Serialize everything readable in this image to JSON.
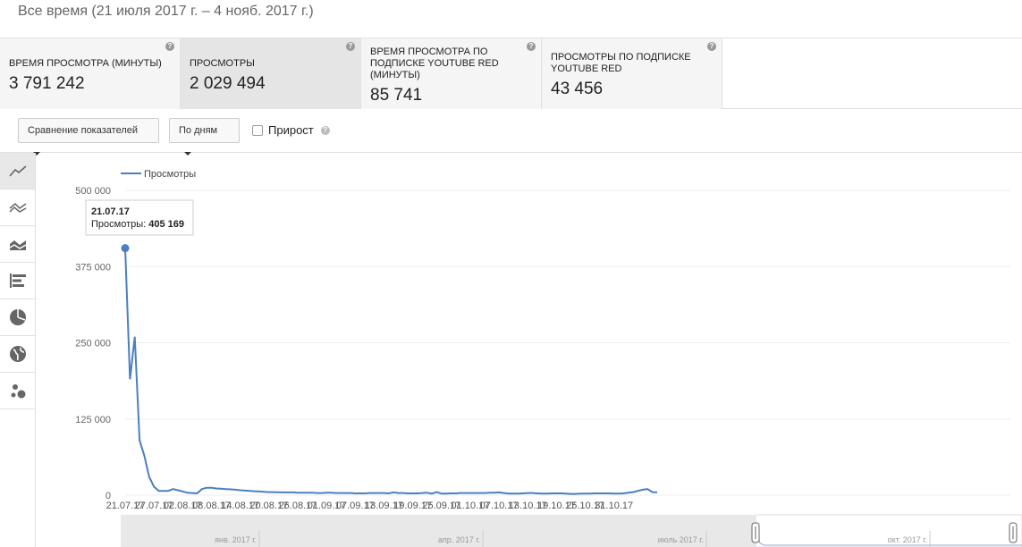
{
  "date_range": "Все время (21 июля 2017 г. – 4 нояб. 2017 г.)",
  "metrics": [
    {
      "label": "ВРЕМЯ ПРОСМОТРА (МИНУТЫ)",
      "value": "3 791 242"
    },
    {
      "label": "ПРОСМОТРЫ",
      "value": "2 029 494"
    },
    {
      "label": "ВРЕМЯ ПРОСМОТРА ПО ПОДПИСКЕ YOUTUBE RED (МИНУТЫ)",
      "value": "85 741"
    },
    {
      "label": "ПРОСМОТРЫ ПО ПОДПИСКЕ YOUTUBE RED",
      "value": "43 456"
    }
  ],
  "toolbar": {
    "compare_label": "Сравнение показателей",
    "period_label": "По дням",
    "growth_label": "Прирост"
  },
  "sidebar": {
    "icons": [
      "line-chart-icon",
      "multi-line-icon",
      "stacked-area-icon",
      "bar-chart-icon",
      "pie-chart-icon",
      "globe-icon",
      "bubble-chart-icon"
    ]
  },
  "tooltip": {
    "date": "21.07.17",
    "label": "Просмотры:",
    "value": "405 169"
  },
  "overview_labels": [
    "янв. 2017 г.",
    "апр. 2017 г.",
    "июль 2017 г.",
    "окт. 2017 г."
  ],
  "chart_data": {
    "type": "line",
    "legend": "Просмотры",
    "color": "#4a7fc1",
    "ylim": [
      0,
      500000
    ],
    "y_ticks": [
      "500 000",
      "375 000",
      "250 000",
      "125 000",
      "0"
    ],
    "x_ticks": [
      "21.07.17",
      "27.07.17",
      "02.08.17",
      "08.08.17",
      "14.08.17",
      "20.08.17",
      "26.08.17",
      "01.09.17",
      "07.09.17",
      "13.09.17",
      "19.09.17",
      "25.09.17",
      "01.10.17",
      "07.10.17",
      "13.10.17",
      "19.10.17",
      "25.10.17",
      "31.10.17"
    ],
    "series": [
      {
        "name": "Просмотры",
        "values": [
          405169,
          190000,
          260000,
          90000,
          65000,
          30000,
          14000,
          7000,
          7000,
          7000,
          10000,
          8000,
          6000,
          4000,
          3500,
          3000,
          10000,
          12000,
          12000,
          11000,
          10500,
          10000,
          9500,
          9000,
          8000,
          7500,
          7000,
          6500,
          6000,
          5500,
          5000,
          5000,
          4800,
          4500,
          4500,
          4500,
          4000,
          4000,
          4000,
          4000,
          3500,
          3500,
          4000,
          4000,
          3500,
          3500,
          3500,
          3500,
          3000,
          3000,
          3000,
          3500,
          3500,
          3500,
          3500,
          3000,
          4500,
          3500,
          3500,
          3000,
          3000,
          3000,
          3500,
          4000,
          2500,
          5000,
          2500,
          2500,
          3000,
          3000,
          3500,
          3500,
          3500,
          3500,
          3500,
          3500,
          4000,
          4000,
          4500,
          3500,
          2500,
          2500,
          2500,
          3000,
          3500,
          3500,
          3000,
          2500,
          2500,
          3000,
          3000,
          3000,
          2500,
          2000,
          2000,
          2500,
          2500,
          2500,
          3000,
          3000,
          3000,
          3000,
          2500,
          2500,
          3000,
          4000,
          5000,
          7000,
          9000,
          10000,
          5000,
          4500
        ]
      }
    ]
  }
}
